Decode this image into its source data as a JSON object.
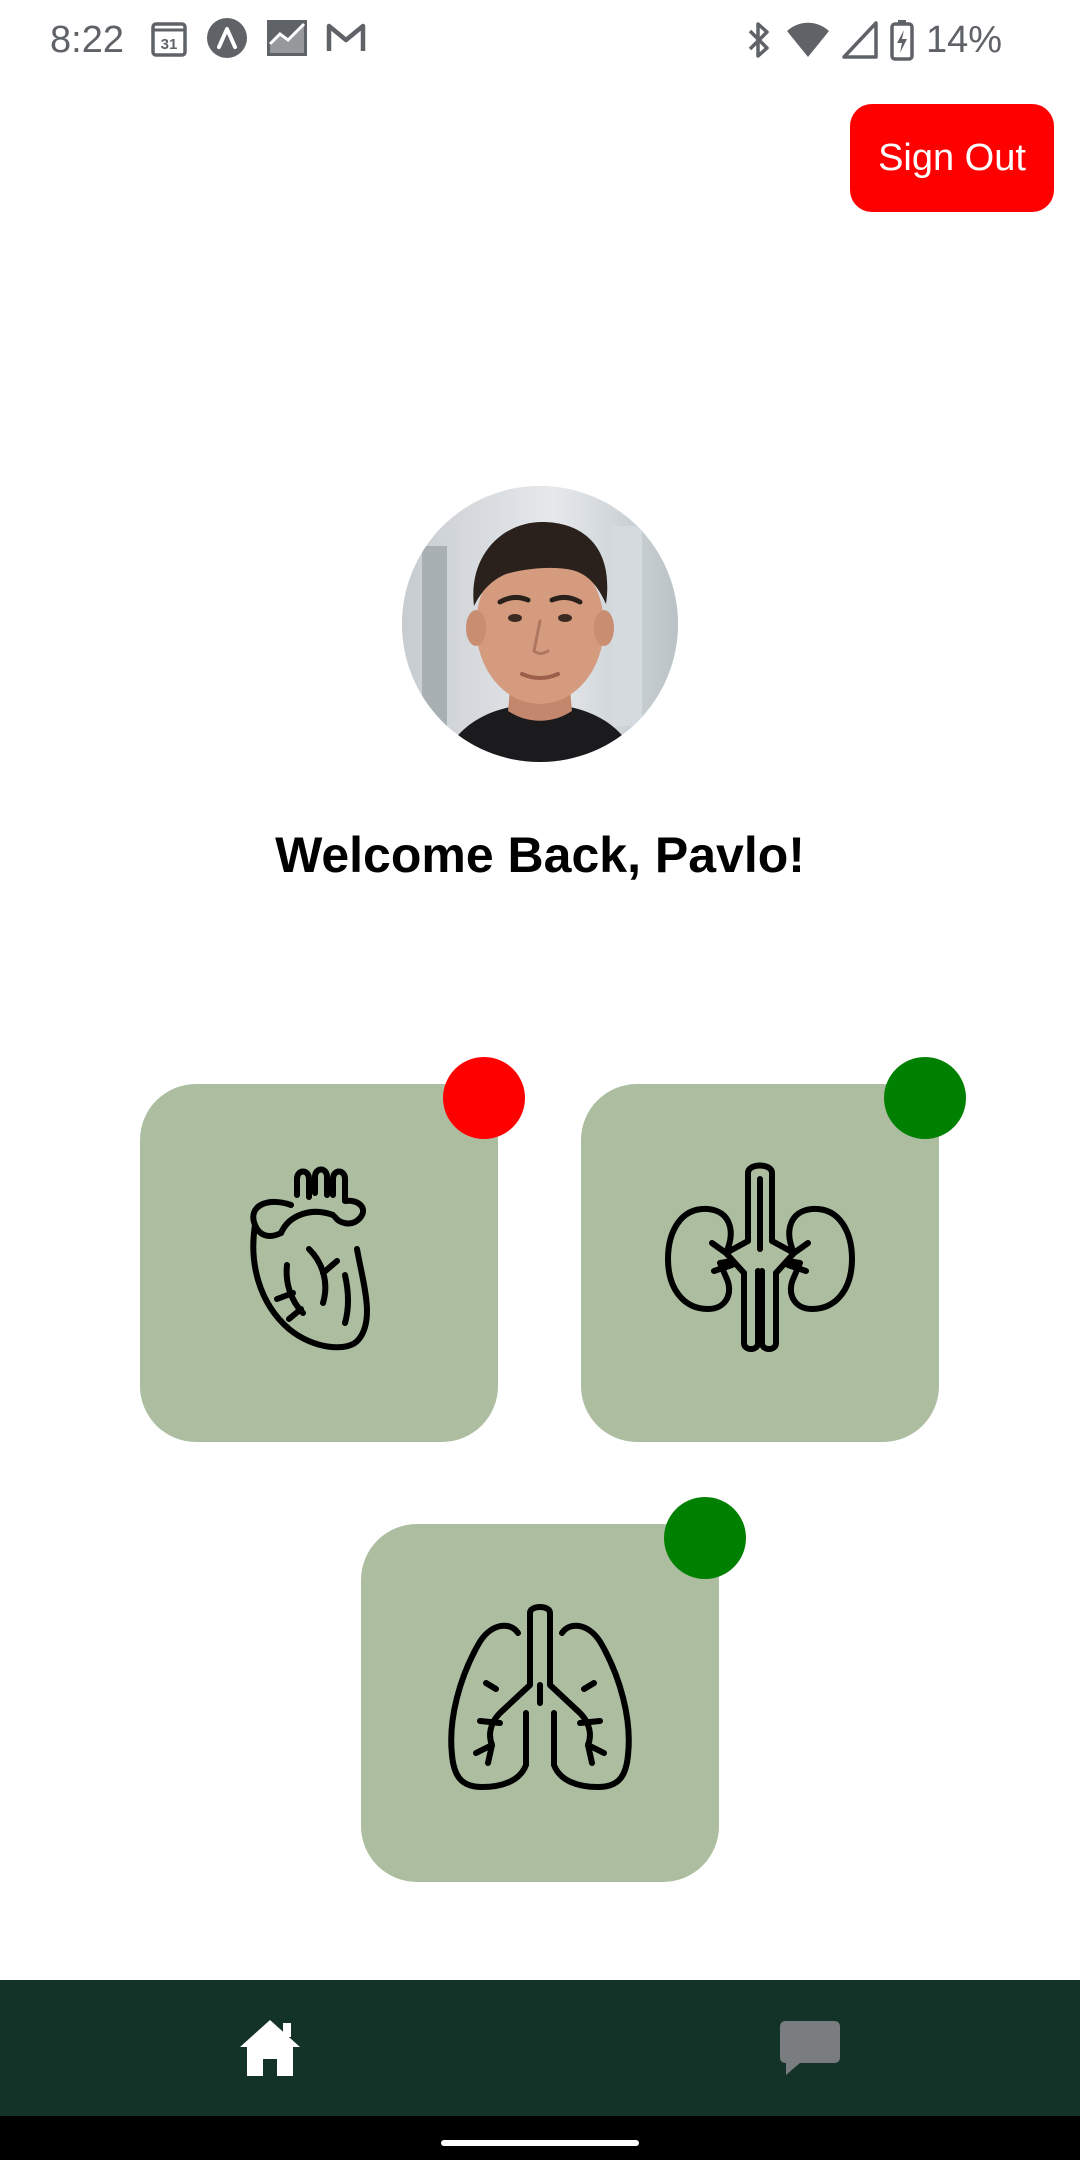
{
  "status_bar": {
    "time": "8:22",
    "calendar_day": "31",
    "battery_percent": "14%",
    "left_icons": [
      "calendar-icon",
      "app-a-icon",
      "chart-app-icon",
      "gmail-icon"
    ],
    "right_icons": [
      "bluetooth-icon",
      "wifi-icon",
      "cell-signal-icon",
      "battery-charging-icon"
    ]
  },
  "header": {
    "sign_out_label": "Sign Out",
    "sign_out_color": "#ff0000"
  },
  "profile": {
    "welcome_text": "Welcome Back, Pavlo!"
  },
  "organs": [
    {
      "icon": "heart-icon",
      "status": "alert",
      "status_color": "#ff0000"
    },
    {
      "icon": "kidneys-icon",
      "status": "ok",
      "status_color": "#008000"
    },
    {
      "icon": "lungs-icon",
      "status": "ok",
      "status_color": "#008000"
    }
  ],
  "card_color": "#acbda0",
  "bottom_nav": {
    "background": "#133328",
    "items": [
      {
        "icon": "home-icon",
        "active": true
      },
      {
        "icon": "chat-icon",
        "active": false
      }
    ]
  }
}
